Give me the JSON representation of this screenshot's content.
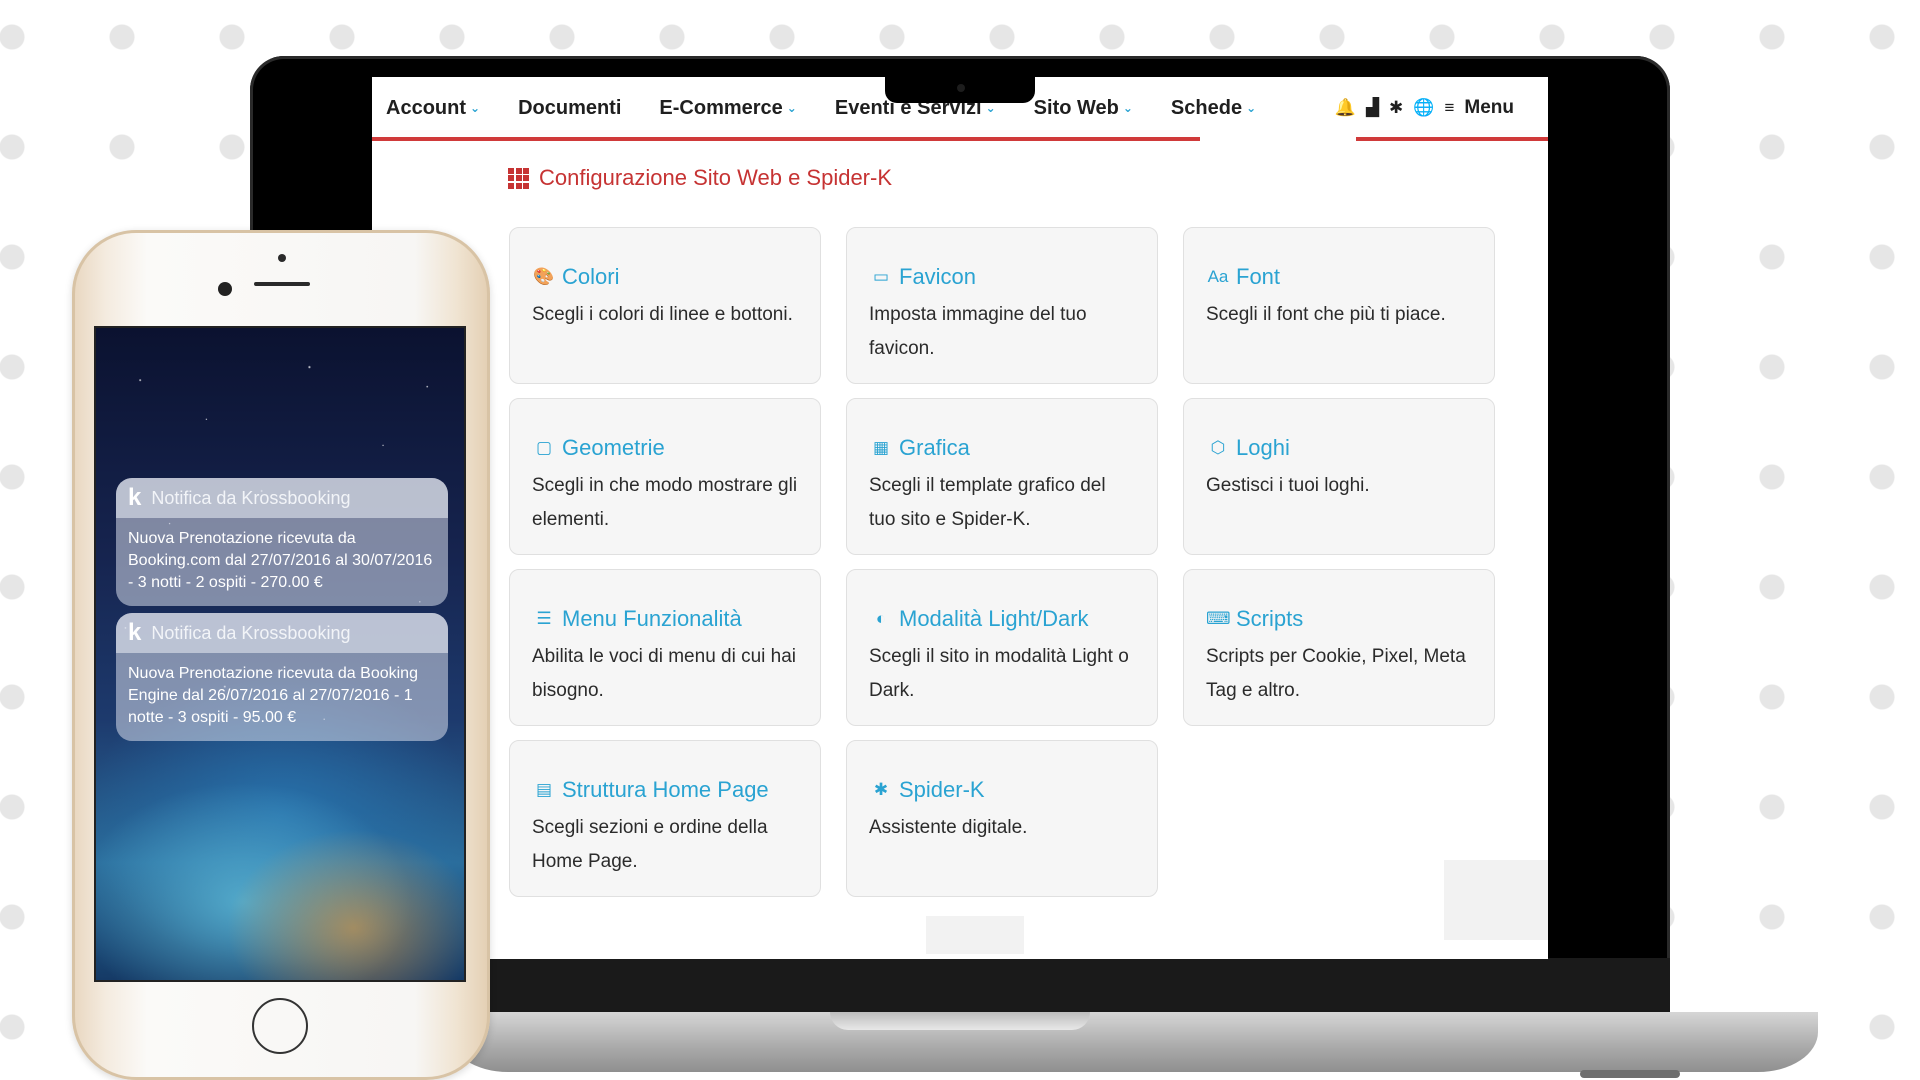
{
  "nav": {
    "items": [
      {
        "label": "Account",
        "has_chevron": true
      },
      {
        "label": "Documenti",
        "has_chevron": false
      },
      {
        "label": "E-Commerce",
        "has_chevron": true
      },
      {
        "label": "Eventi e Servizi",
        "has_chevron": true
      },
      {
        "label": "Sito Web",
        "has_chevron": true
      },
      {
        "label": "Schede",
        "has_chevron": true
      }
    ],
    "right_icons": [
      "bell-icon",
      "signal-icon",
      "spider-icon",
      "globe-icon"
    ],
    "menu_label": "Menu",
    "accent_color": "#d03a3a"
  },
  "page": {
    "title": "Configurazione Sito Web e Spider-K",
    "title_color": "#c63333"
  },
  "cards": [
    {
      "icon": "palette-icon",
      "glyph": "🎨",
      "title": "Colori",
      "desc": "Scegli i colori di linee e bottoni."
    },
    {
      "icon": "favicon-icon",
      "glyph": "▭",
      "title": "Favicon",
      "desc": "Imposta immagine del tuo favicon."
    },
    {
      "icon": "font-icon",
      "glyph": "Aa",
      "title": "Font",
      "desc": "Scegli il font che più ti piace."
    },
    {
      "icon": "square-icon",
      "glyph": "▢",
      "title": "Geometrie",
      "desc": "Scegli in che modo mostrare gli elementi."
    },
    {
      "icon": "layers-icon",
      "glyph": "▦",
      "title": "Grafica",
      "desc": "Scegli il template grafico del tuo sito e Spider-K."
    },
    {
      "icon": "shield-icon",
      "glyph": "⬡",
      "title": "Loghi",
      "desc": "Gestisci i tuoi loghi."
    },
    {
      "icon": "list-icon",
      "glyph": "☰",
      "title": "Menu Funzionalità",
      "desc": "Abilita le voci di menu di cui hai bisogno."
    },
    {
      "icon": "contrast-icon",
      "glyph": "◐",
      "title": "Modalità Light/Dark",
      "desc": "Scegli il sito in modalità Light o Dark."
    },
    {
      "icon": "code-icon",
      "glyph": "⌨",
      "title": "Scripts",
      "desc": "Scripts per Cookie, Pixel, Meta Tag e altro."
    },
    {
      "icon": "layout-icon",
      "glyph": "▤",
      "title": "Struttura Home Page",
      "desc": "Scegli sezioni e ordine della Home Page."
    },
    {
      "icon": "spider-icon",
      "glyph": "✱",
      "title": "Spider-K",
      "desc": "Assistente digitale."
    }
  ],
  "card_accent_color": "#2aa3d2",
  "notifications": [
    {
      "header": "Notifica da Krossbooking",
      "body": "Nuova Prenotazione ricevuta da Booking.com dal 27/07/2016 al 30/07/2016 - 3 notti - 2 ospiti - 270.00 €"
    },
    {
      "header": "Notifica da Krossbooking",
      "body": "Nuova Prenotazione ricevuta da Booking Engine dal 26/07/2016 al 27/07/2016 - 1 notte - 3 ospiti - 95.00 €"
    }
  ]
}
